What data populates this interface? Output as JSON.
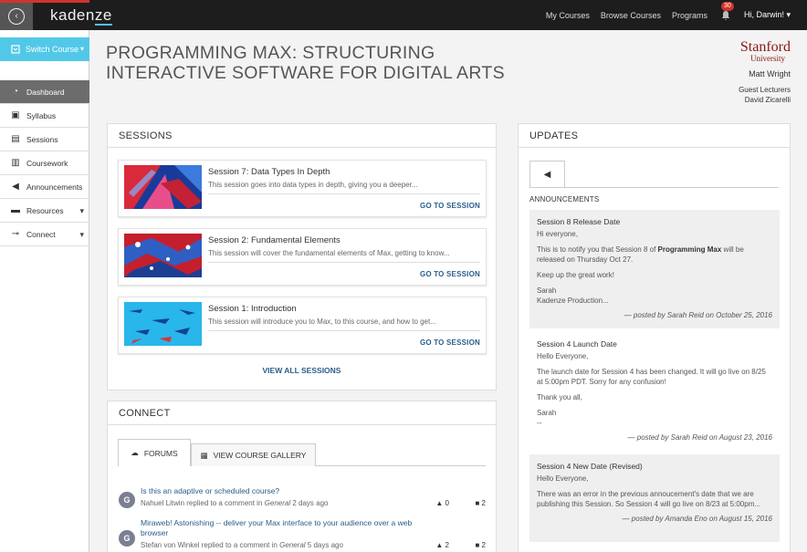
{
  "topbar": {
    "back_glyph": "‹",
    "logo_main": "kaden",
    "logo_accent": "ze",
    "nav": [
      "My Courses",
      "Browse Courses",
      "Programs"
    ],
    "notifications_count": "30",
    "user": "Hi, Darwin! ▾"
  },
  "sidebar": {
    "switch_label": "Switch Course",
    "items": [
      {
        "label": "Dashboard",
        "icon": "dashboard-gauge-icon"
      },
      {
        "label": "Syllabus",
        "icon": "syllabus-icon"
      },
      {
        "label": "Sessions",
        "icon": "sessions-icon"
      },
      {
        "label": "Coursework",
        "icon": "coursework-icon"
      },
      {
        "label": "Announcements",
        "icon": "megaphone-icon"
      },
      {
        "label": "Resources",
        "icon": "folder-icon"
      },
      {
        "label": "Connect",
        "icon": "connect-icon"
      }
    ]
  },
  "header": {
    "title_line1": "PROGRAMMING MAX: STRUCTURING",
    "title_line2": "INTERACTIVE SOFTWARE FOR DIGITAL ARTS",
    "university_name": "Stanford",
    "university_sub": "University",
    "instructor": "Matt Wright",
    "guest_label": "Guest Lecturers",
    "guest_name": "David Zicarelli"
  },
  "sessions": {
    "heading": "SESSIONS",
    "items": [
      {
        "title": "Session 7: Data Types In Depth",
        "desc": "This session goes into data types in depth, giving you a deeper...",
        "link": "GO TO SESSION"
      },
      {
        "title": "Session 2: Fundamental Elements",
        "desc": "This session will cover the fundamental elements of Max, getting to know...",
        "link": "GO TO SESSION"
      },
      {
        "title": "Session 1: Introduction",
        "desc": "This session will introduce you to Max, to this course, and how to get...",
        "link": "GO TO SESSION"
      }
    ],
    "view_all": "VIEW ALL SESSIONS"
  },
  "connect": {
    "heading": "CONNECT",
    "tab_forums": "FORUMS",
    "tab_gallery": "VIEW COURSE GALLERY",
    "posts": [
      {
        "avatar": "G",
        "title": "Is this an adaptive or scheduled course?",
        "author": "Nahuel Litwin replied to a comment in",
        "category": "General",
        "time": "2 days ago",
        "votes": "0",
        "replies": "2"
      },
      {
        "avatar": "G",
        "title": "Miraweb! Astonishing -- deliver your Max interface to your audience over a web browser",
        "author": "Stefan von Winkel replied to a comment in",
        "category": "General",
        "time": "5 days ago",
        "votes": "2",
        "replies": "2"
      }
    ]
  },
  "updates": {
    "heading": "UPDATES",
    "announcements_label": "ANNOUNCEMENTS",
    "items": [
      {
        "title": "Session 8 Release Date",
        "p1": "Hi everyone,",
        "p2a": "This is to notify you that Session 8 of ",
        "p2b": "Programming Max",
        "p2c": " will be released on Thursday Oct 27.",
        "p3": "Keep up the great work!",
        "p4a": "Sarah",
        "p4b": "Kadenze Production...",
        "posted": "— posted by Sarah Reid on October 25, 2016"
      },
      {
        "title": "Session 4 Launch Date",
        "p1": "Hello Everyone,",
        "p2": "The launch date for Session 4 has been changed. It will go live on 8/25 at 5:00pm PDT. Sorry for any confusion!",
        "p3": "Thank you all,",
        "p4a": "Sarah",
        "p4b": "--",
        "posted": "— posted by Sarah Reid on August 23, 2016"
      },
      {
        "title": "Session 4 New Date (Revised)",
        "p1": "Hello Everyone,",
        "p2": "There was an error in the previous annoucement's date that we are publishing this Session. So Session 4 will go live on 8/23 at 5:00pm...",
        "posted": "— posted by Amanda Eno on August 15, 2016"
      }
    ]
  },
  "colors": {
    "accent": "#52c8e8",
    "link": "#2a5d8a",
    "stanford": "#8c1515",
    "topbar": "#1d1d1d"
  }
}
